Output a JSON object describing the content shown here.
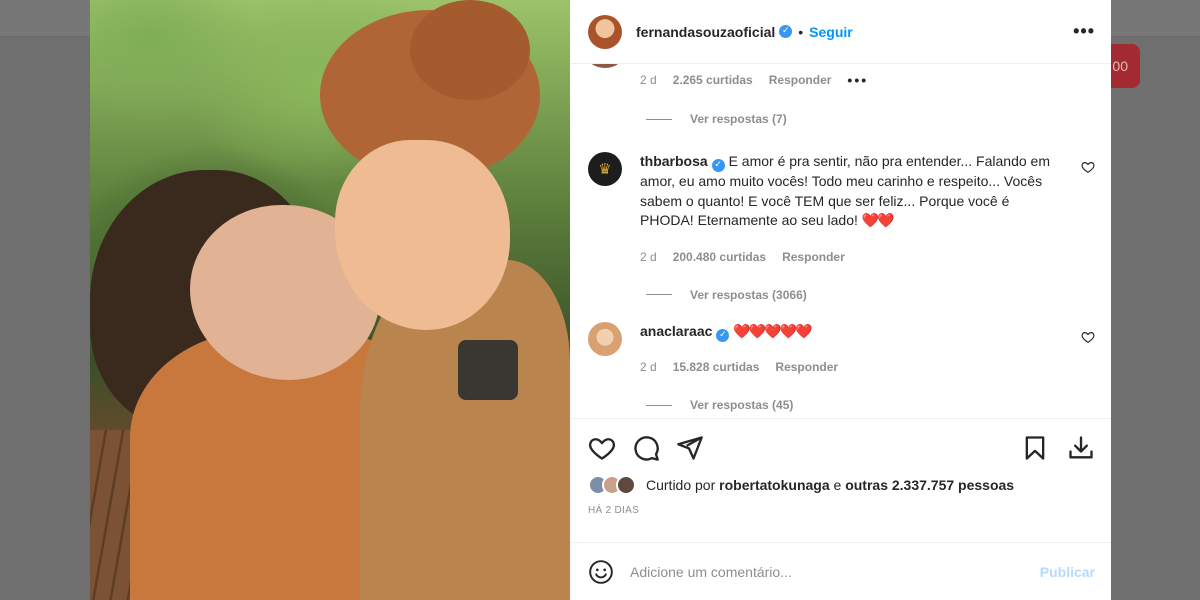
{
  "background": {
    "pill_text": "00"
  },
  "post": {
    "owner_username": "fernandasouzaoficial",
    "separator": "•",
    "follow_label": "Seguir",
    "more_label": "•••"
  },
  "comments": {
    "previous": {
      "date": "2 d",
      "likes": "2.265 curtidas",
      "reply": "Responder",
      "options": "•••",
      "view_replies": "Ver respostas (7)"
    },
    "items": [
      {
        "username": "thbarbosa",
        "avatar_icon": "crown-icon",
        "text": "E amor é pra sentir, não pra entender... Falando em amor, eu amo muito vocês! Todo meu carinho e respeito... Vocês sabem o quanto! E você TEM que ser feliz... Porque você é PHODA! Eternamente ao seu lado!",
        "emoji": "❤️❤️",
        "date": "2 d",
        "likes": "200.480 curtidas",
        "reply": "Responder",
        "view_replies": "Ver respostas (3066)"
      },
      {
        "username": "anaclaraac",
        "text": "",
        "emoji": "❤️❤️❤️❤️❤️",
        "date": "2 d",
        "likes": "15.828 curtidas",
        "reply": "Responder",
        "view_replies": "Ver respostas (45)"
      }
    ]
  },
  "actions": {
    "liked_by_prefix": "Curtido por",
    "liked_by_user": "robertatokunaga",
    "liked_by_and": "e",
    "liked_by_others": "outras 2.337.757 pessoas",
    "post_date": "HÁ 2 DIAS"
  },
  "add_comment": {
    "placeholder": "Adicione um comentário...",
    "publish_label": "Publicar"
  },
  "colors": {
    "link_blue": "#0095f6",
    "publish_disabled": "#b3dbff",
    "heart_red": "#ed4956",
    "secondary_text": "#8e8e8e",
    "verified_blue": "#3897f0"
  }
}
